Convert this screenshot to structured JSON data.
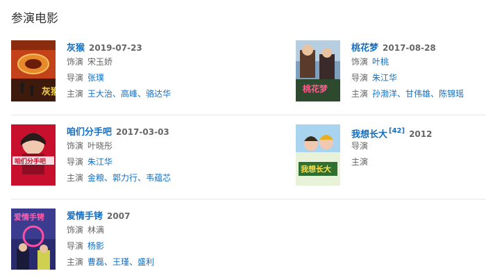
{
  "section": {
    "title": "参演电影"
  },
  "films": [
    {
      "title": "灰猴",
      "date": "2019-07-23",
      "role_label": "饰演",
      "role": "宋玉娇",
      "director_label": "导演",
      "directors": [
        "张璞"
      ],
      "cast_label": "主演",
      "cast": [
        "王大治",
        "高峰",
        "骆达华"
      ],
      "poster_text": "灰猴"
    },
    {
      "title": "桃花梦",
      "date": "2017-08-28",
      "role_label": "饰演",
      "role": "叶桃",
      "director_label": "导演",
      "directors": [
        "朱江华"
      ],
      "cast_label": "主演",
      "cast": [
        "孙渤洋",
        "甘伟雄",
        "陈锦瑶"
      ],
      "poster_text": "桃花梦"
    },
    {
      "title": "咱们分手吧",
      "date": "2017-03-03",
      "role_label": "饰演",
      "role": "叶晓彤",
      "director_label": "导演",
      "directors": [
        "朱江华"
      ],
      "cast_label": "主演",
      "cast": [
        "金粮",
        "郭力行",
        "韦蕴芯"
      ],
      "poster_text": "咱们分手吧"
    },
    {
      "title": "我想长大",
      "ref": "[42]",
      "date": "2012",
      "director_label": "导演",
      "cast_label": "主演",
      "poster_text": "我想长大"
    },
    {
      "title": "爱情手铐",
      "date": "2007",
      "role_label": "饰演",
      "role": "林满",
      "director_label": "导演",
      "directors": [
        "杨影"
      ],
      "cast_label": "主演",
      "cast": [
        "曹磊",
        "王瑾",
        "盛利"
      ],
      "poster_text": "爱情手铐"
    }
  ]
}
